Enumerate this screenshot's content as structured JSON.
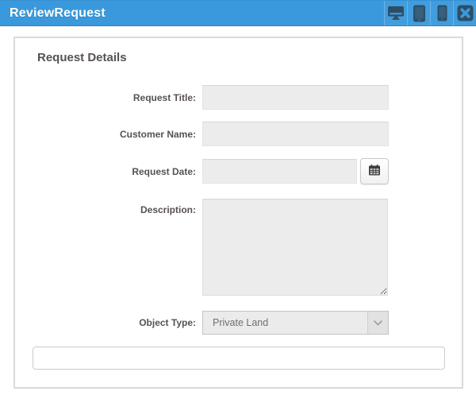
{
  "header": {
    "title": "ReviewRequest",
    "buttons": [
      {
        "icon": "desktop-icon"
      },
      {
        "icon": "tablet-icon"
      },
      {
        "icon": "phone-icon"
      },
      {
        "icon": "close-icon"
      }
    ]
  },
  "form": {
    "heading": "Request Details",
    "fields": [
      {
        "label": "Request Title:",
        "value": ""
      },
      {
        "label": "Customer Name:",
        "value": ""
      },
      {
        "label": "Request Date:",
        "value": ""
      },
      {
        "label": "Description:",
        "value": ""
      },
      {
        "label": "Object Type:",
        "value": "Private Land"
      }
    ],
    "footer_input_value": ""
  },
  "colors": {
    "header_bg": "#3a99dc",
    "header_icon": "#2d4f66",
    "header_separator": "#6db4e8",
    "title_text": "#ffffff",
    "label_text": "#575152",
    "field_bg": "#ececec",
    "panel_border": "#dadada",
    "select_text": "#6f6f6f"
  }
}
